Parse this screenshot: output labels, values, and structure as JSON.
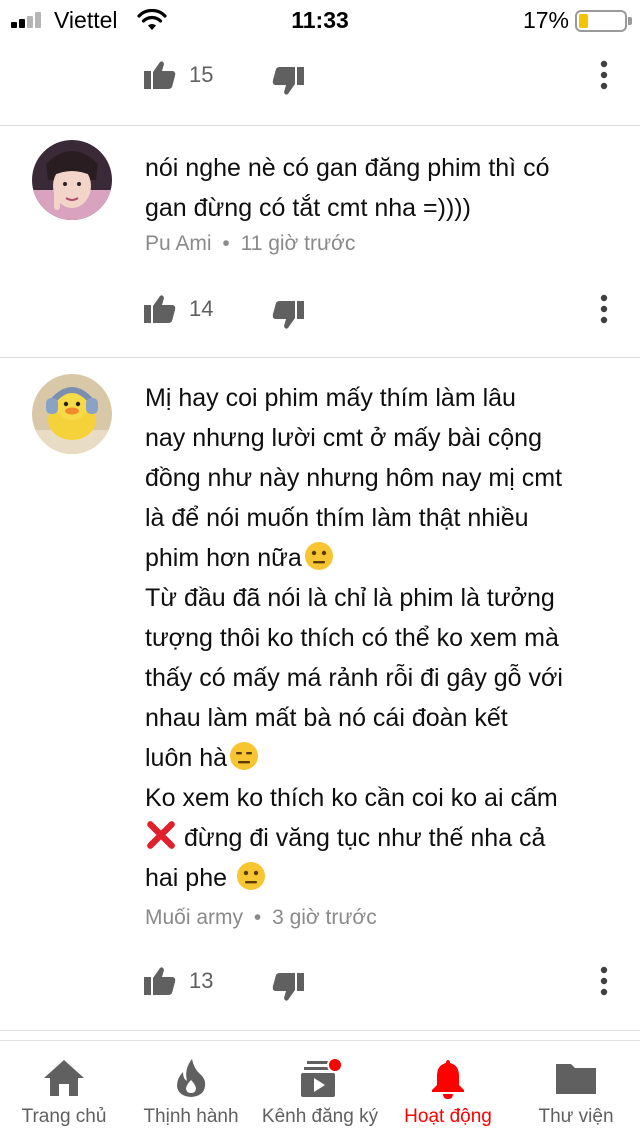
{
  "status_bar": {
    "carrier": "Viettel",
    "time": "11:33",
    "battery": "17%"
  },
  "comments": [
    {
      "like_count": "15"
    },
    {
      "lines": [
        "nói nghe nè có gan đăng phim thì có",
        "gan đừng có tắt cmt nha =))))"
      ],
      "author": "Pu Ami",
      "separator": "•",
      "time": "11 giờ trước",
      "like_count": "14"
    },
    {
      "lines": [
        "Mị hay coi phim mấy thím làm lâu",
        "nay nhưng lười cmt ở mấy bài cộng",
        "đồng như này nhưng hôm nay mị cmt",
        "là để nói muốn thím làm thật nhiều",
        "phim hơn nữa",
        "Từ đầu đã nói là chỉ là phim là tưởng",
        "tượng thôi ko thích có thể ko xem mà",
        "thấy có mấy má rảnh rỗi đi gây gỗ với",
        "nhau làm mất bà nó cái đoàn kết",
        "luôn hà",
        "Ko xem ko thích ko cần coi ko ai cấm",
        " đừng đi văng tục như thế nha cả",
        "hai phe "
      ],
      "author": "Muối army",
      "separator": "•",
      "time": "3 giờ trước",
      "like_count": "13"
    }
  ],
  "bottom_nav": [
    {
      "label": "Trang chủ",
      "icon": "home-icon"
    },
    {
      "label": "Thịnh hành",
      "icon": "flame-icon"
    },
    {
      "label": "Kênh đăng ký",
      "icon": "subscriptions-icon"
    },
    {
      "label": "Hoạt động",
      "icon": "bell-icon",
      "active": true
    },
    {
      "label": "Thư viện",
      "icon": "folder-icon"
    }
  ],
  "colors": {
    "accent": "#ff0000",
    "text": "#0f0f0f",
    "meta": "#8a8a8a",
    "icon": "#606060"
  }
}
